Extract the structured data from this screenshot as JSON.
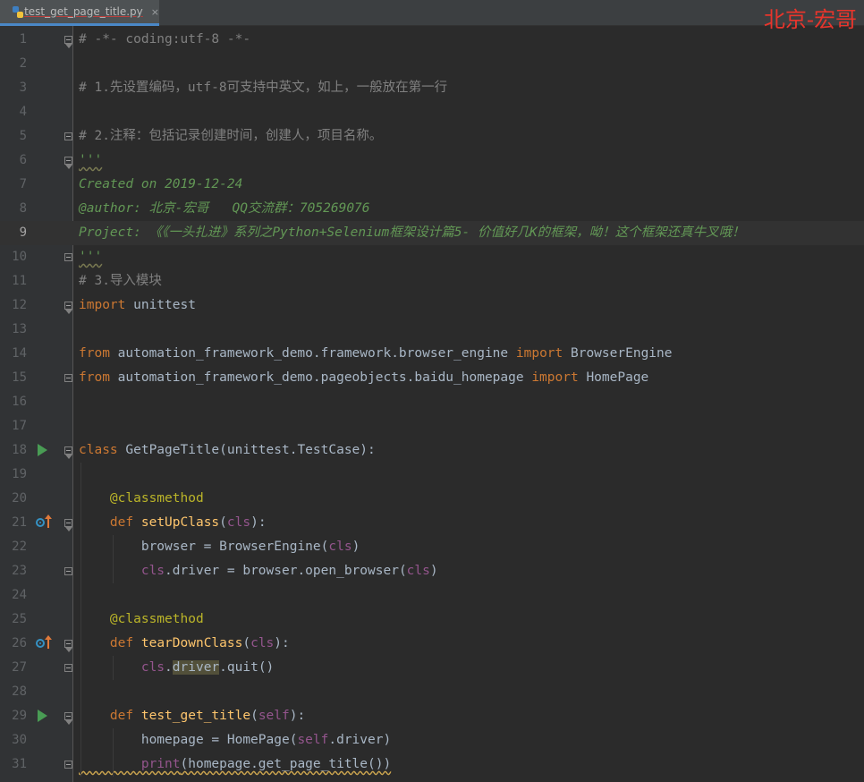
{
  "tab": {
    "file_name": "test_get_page_title.py",
    "close_symbol": "×",
    "icon": "python-file-icon"
  },
  "watermark": "北京-宏哥",
  "current_line": 9,
  "lines": [
    {
      "n": "1",
      "tokens": [
        {
          "t": "# -*- coding:utf-8 -*-",
          "c": "comment"
        }
      ],
      "fold": "start"
    },
    {
      "n": "2",
      "tokens": []
    },
    {
      "n": "3",
      "tokens": [
        {
          "t": "# 1.先设置编码，utf-8可支持中英文，如上，一般放在第一行",
          "c": "comment"
        }
      ]
    },
    {
      "n": "4",
      "tokens": []
    },
    {
      "n": "5",
      "tokens": [
        {
          "t": "# 2.注释：包括记录创建时间，创建人，项目名称。",
          "c": "comment"
        }
      ],
      "fold": "end"
    },
    {
      "n": "6",
      "tokens": [
        {
          "t": "'''",
          "c": "doc-wavy"
        }
      ],
      "fold": "start"
    },
    {
      "n": "7",
      "tokens": [
        {
          "t": "Created on 2019-12-24",
          "c": "doc"
        }
      ]
    },
    {
      "n": "8",
      "tokens": [
        {
          "t": "@author: 北京-宏哥   QQ交流群：705269076",
          "c": "doc"
        }
      ]
    },
    {
      "n": "9",
      "tokens": [
        {
          "t": "Project: 《《一头扎进》系列之Python+Selenium框架设计篇5- 价值好几K的框架，呦！这个框架还真牛叉哦！",
          "c": "doc"
        }
      ]
    },
    {
      "n": "10",
      "tokens": [
        {
          "t": "'''",
          "c": "doc-wavy"
        }
      ],
      "fold": "end"
    },
    {
      "n": "11",
      "tokens": [
        {
          "t": "# 3.导入模块",
          "c": "comment"
        }
      ]
    },
    {
      "n": "12",
      "tokens": [
        {
          "t": "import",
          "c": "kw"
        },
        {
          "t": " unittest",
          "c": "plain"
        }
      ],
      "fold": "start"
    },
    {
      "n": "13",
      "tokens": []
    },
    {
      "n": "14",
      "tokens": [
        {
          "t": "from",
          "c": "kw"
        },
        {
          "t": " automation_framework_demo.framework.browser_engine ",
          "c": "plain"
        },
        {
          "t": "import",
          "c": "kw"
        },
        {
          "t": " BrowserEngine",
          "c": "plain"
        }
      ]
    },
    {
      "n": "15",
      "tokens": [
        {
          "t": "from",
          "c": "kw"
        },
        {
          "t": " automation_framework_demo.pageobjects.baidu_homepage ",
          "c": "plain"
        },
        {
          "t": "import",
          "c": "kw"
        },
        {
          "t": " HomePage",
          "c": "plain"
        }
      ],
      "fold": "end"
    },
    {
      "n": "16",
      "tokens": []
    },
    {
      "n": "17",
      "tokens": []
    },
    {
      "n": "18",
      "tokens": [
        {
          "t": "class",
          "c": "kw"
        },
        {
          "t": " GetPageTitle(unittest.TestCase):",
          "c": "plain"
        }
      ],
      "fold": "start",
      "icon": "run"
    },
    {
      "n": "19",
      "tokens": []
    },
    {
      "n": "20",
      "tokens": [
        {
          "t": "    ",
          "c": "plain"
        },
        {
          "t": "@classmethod",
          "c": "deco"
        }
      ]
    },
    {
      "n": "21",
      "tokens": [
        {
          "t": "    ",
          "c": "plain"
        },
        {
          "t": "def",
          "c": "kw"
        },
        {
          "t": " ",
          "c": "plain"
        },
        {
          "t": "setUpClass",
          "c": "fn"
        },
        {
          "t": "(",
          "c": "plain"
        },
        {
          "t": "cls",
          "c": "self"
        },
        {
          "t": "):",
          "c": "plain"
        }
      ],
      "fold": "start",
      "icon": "override"
    },
    {
      "n": "22",
      "tokens": [
        {
          "t": "        browser = BrowserEngine(",
          "c": "plain"
        },
        {
          "t": "cls",
          "c": "self"
        },
        {
          "t": ")",
          "c": "plain"
        }
      ]
    },
    {
      "n": "23",
      "tokens": [
        {
          "t": "        ",
          "c": "plain"
        },
        {
          "t": "cls",
          "c": "self"
        },
        {
          "t": ".driver = browser.open_browser(",
          "c": "plain"
        },
        {
          "t": "cls",
          "c": "self"
        },
        {
          "t": ")",
          "c": "plain"
        }
      ],
      "fold": "end"
    },
    {
      "n": "24",
      "tokens": []
    },
    {
      "n": "25",
      "tokens": [
        {
          "t": "    ",
          "c": "plain"
        },
        {
          "t": "@classmethod",
          "c": "deco"
        }
      ]
    },
    {
      "n": "26",
      "tokens": [
        {
          "t": "    ",
          "c": "plain"
        },
        {
          "t": "def",
          "c": "kw"
        },
        {
          "t": " ",
          "c": "plain"
        },
        {
          "t": "tearDownClass",
          "c": "fn"
        },
        {
          "t": "(",
          "c": "plain"
        },
        {
          "t": "cls",
          "c": "self"
        },
        {
          "t": "):",
          "c": "plain"
        }
      ],
      "fold": "start",
      "icon": "override"
    },
    {
      "n": "27",
      "tokens": [
        {
          "t": "        ",
          "c": "plain"
        },
        {
          "t": "cls",
          "c": "self"
        },
        {
          "t": ".",
          "c": "plain"
        },
        {
          "t": "driver",
          "c": "hl"
        },
        {
          "t": ".quit()",
          "c": "plain"
        }
      ],
      "fold": "end"
    },
    {
      "n": "28",
      "tokens": []
    },
    {
      "n": "29",
      "tokens": [
        {
          "t": "    ",
          "c": "plain"
        },
        {
          "t": "def",
          "c": "kw"
        },
        {
          "t": " ",
          "c": "plain"
        },
        {
          "t": "test_get_title",
          "c": "fn"
        },
        {
          "t": "(",
          "c": "plain"
        },
        {
          "t": "self",
          "c": "self"
        },
        {
          "t": "):",
          "c": "plain"
        }
      ],
      "fold": "start",
      "icon": "run"
    },
    {
      "n": "30",
      "tokens": [
        {
          "t": "        homepage = HomePage(",
          "c": "plain"
        },
        {
          "t": "self",
          "c": "self"
        },
        {
          "t": ".driver)",
          "c": "plain"
        }
      ]
    },
    {
      "n": "31",
      "tokens": [
        {
          "t": "        ",
          "c": "plain-wavy"
        },
        {
          "t": "print",
          "c": "self-wavy"
        },
        {
          "t": "(homepage.get_page_title())",
          "c": "plain-wavy"
        }
      ],
      "fold": "end"
    }
  ]
}
